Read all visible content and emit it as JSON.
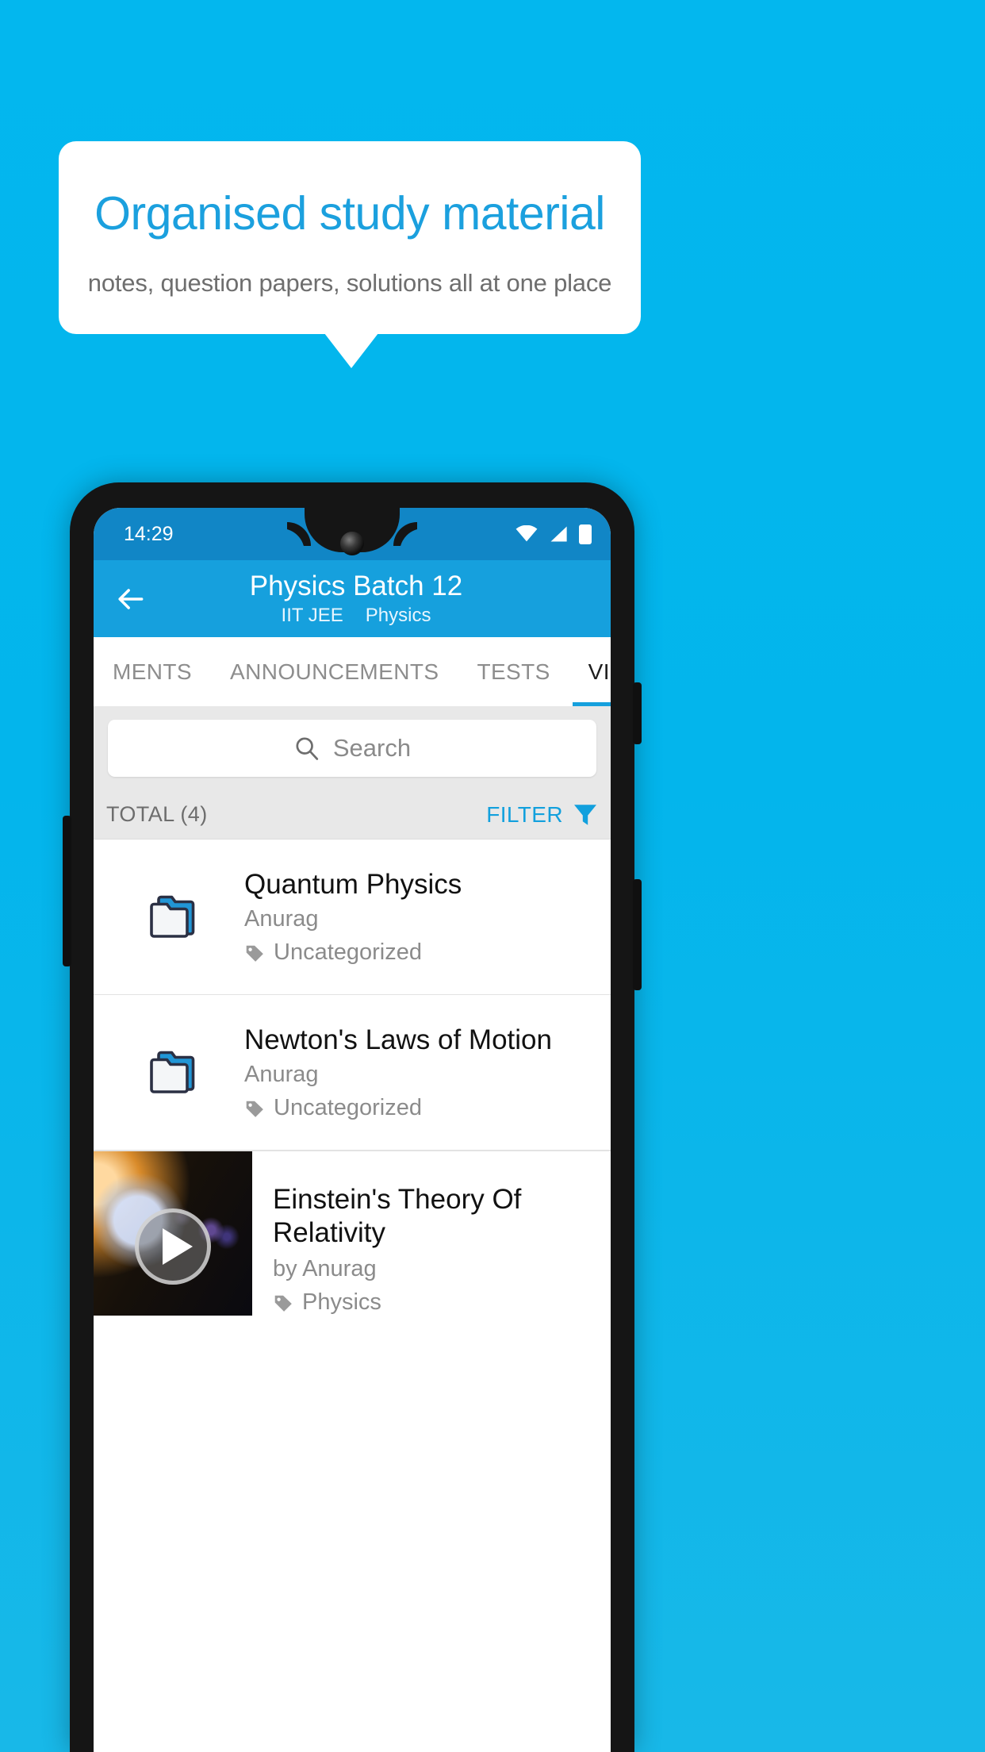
{
  "promo": {
    "title": "Organised study material",
    "subtitle": "notes, question papers, solutions all at one place",
    "accent_color": "#1ba0de",
    "background_color": "#03b5ec"
  },
  "phone": {
    "statusbar": {
      "time": "14:29",
      "icons": [
        "wifi-icon",
        "signal-icon",
        "battery-icon"
      ],
      "background_color": "#1186c6"
    },
    "appbar": {
      "back_icon": "arrow-left-icon",
      "title": "Physics Batch 12",
      "subtitle_exam": "IIT JEE",
      "subtitle_subject": "Physics",
      "background_color": "#16a0dd"
    },
    "tabs": [
      {
        "label": "MENTS",
        "active": false
      },
      {
        "label": "ANNOUNCEMENTS",
        "active": false
      },
      {
        "label": "TESTS",
        "active": false
      },
      {
        "label": "VIDEOS",
        "active": true
      }
    ],
    "search": {
      "placeholder": "Search",
      "icon": "search-icon",
      "value": ""
    },
    "listheader": {
      "total_label": "TOTAL (4)",
      "filter_label": "FILTER",
      "filter_icon": "filter-icon",
      "filter_color": "#12a0dd"
    },
    "items": [
      {
        "type": "folder",
        "icon": "folder-icon",
        "title": "Quantum Physics",
        "author": "Anurag",
        "tag_icon": "tag-icon",
        "tag": "Uncategorized"
      },
      {
        "type": "folder",
        "icon": "folder-icon",
        "title": "Newton's Laws of Motion",
        "author": "Anurag",
        "tag_icon": "tag-icon",
        "tag": "Uncategorized"
      },
      {
        "type": "video",
        "icon": "play-icon",
        "title": "Einstein's Theory Of Relativity",
        "author": "by Anurag",
        "tag_icon": "tag-icon",
        "tag": "Physics"
      }
    ]
  }
}
